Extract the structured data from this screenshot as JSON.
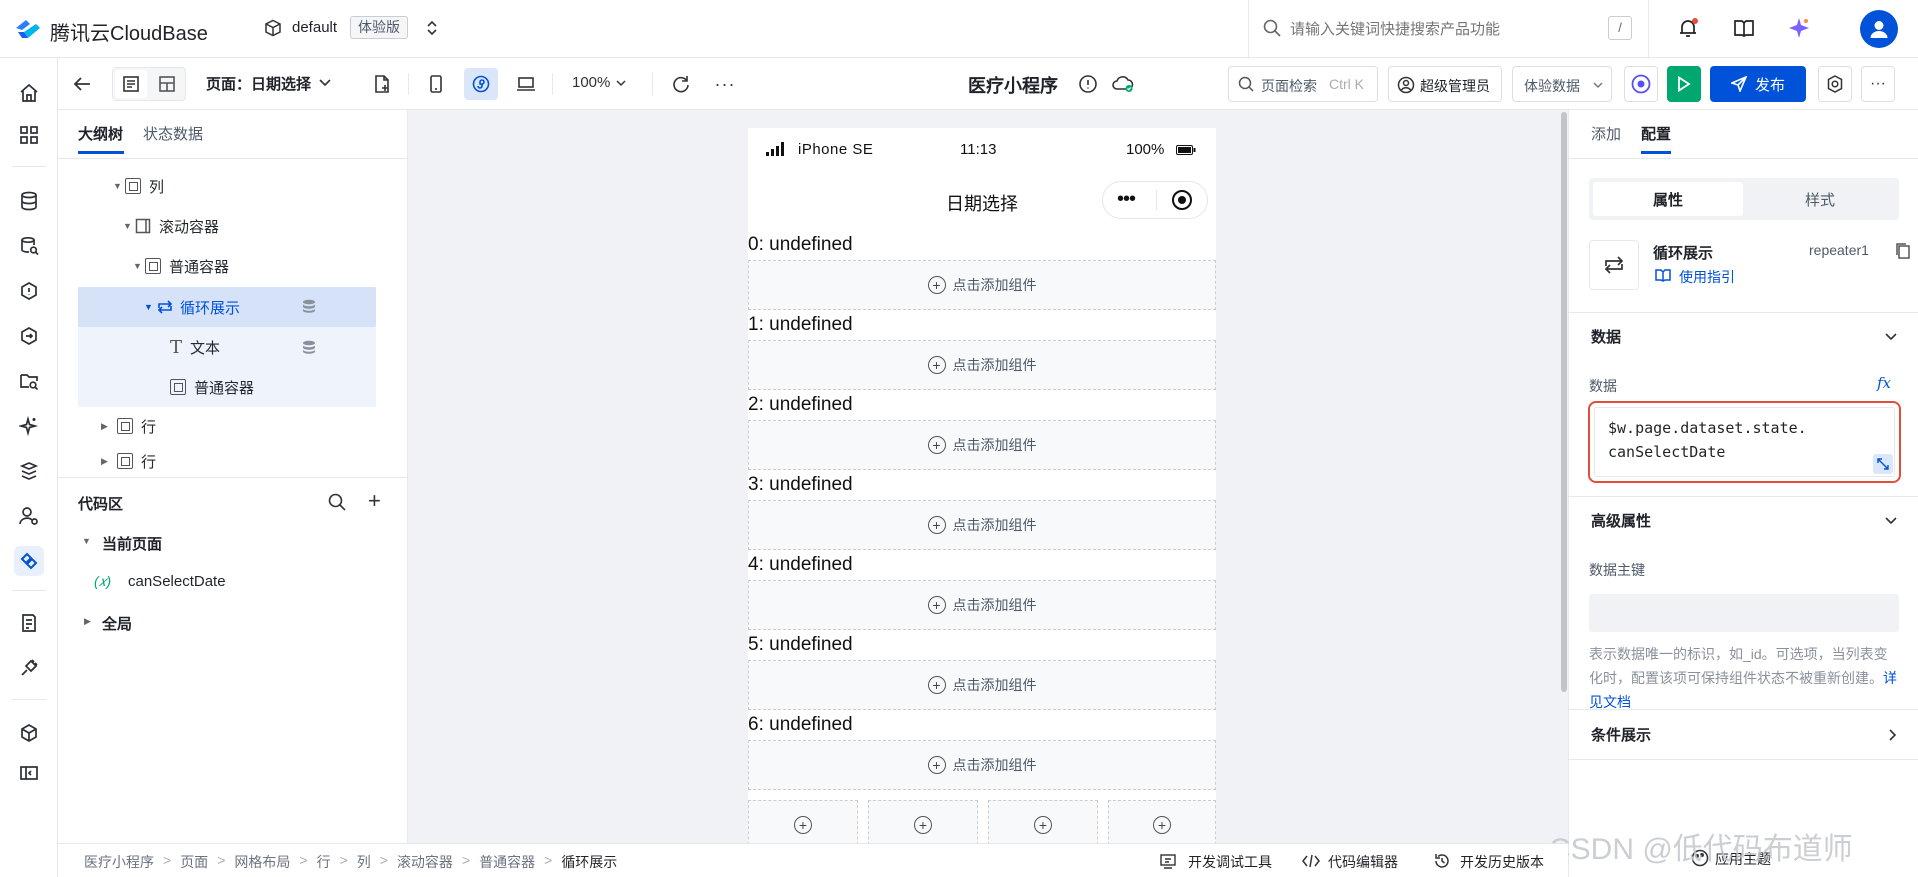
{
  "app": {
    "title": "腾讯云CloudBase",
    "env_name": "default",
    "env_badge": "体验版"
  },
  "header": {
    "search_placeholder": "请输入关键词快捷搜索产品功能",
    "search_shortcut": "/"
  },
  "toolbar": {
    "page_label": "页面：日期选择",
    "zoom": "100%",
    "project_title": "医疗小程序",
    "page_search": "页面检索",
    "page_search_shortcut": "Ctrl K",
    "admin": "超级管理员",
    "data_mode": "体验数据",
    "publish": "发布"
  },
  "left_panel": {
    "tabs": [
      "大纲树",
      "状态数据"
    ],
    "tree": [
      {
        "label": "列",
        "indent": 0
      },
      {
        "label": "滚动容器",
        "indent": 1
      },
      {
        "label": "普通容器",
        "indent": 2
      },
      {
        "label": "循环展示",
        "indent": 3
      },
      {
        "label": "文本",
        "indent": 4
      },
      {
        "label": "普通容器",
        "indent": 4
      },
      {
        "label": "行",
        "indent": 0
      },
      {
        "label": "行",
        "indent": 0
      }
    ],
    "code_title": "代码区",
    "code_current": "当前页面",
    "code_var": "canSelectDate",
    "code_var_icon": "(𝑥)",
    "code_global": "全局"
  },
  "phone": {
    "device": "iPhone SE",
    "time": "11:13",
    "battery": "100%",
    "page_title": "日期选择",
    "items": [
      "0: undefined",
      "1: undefined",
      "2: undefined",
      "3: undefined",
      "4: undefined",
      "5: undefined",
      "6: undefined"
    ],
    "add_component": "点击添加组件"
  },
  "right_panel": {
    "tabs": [
      "添加",
      "配置"
    ],
    "subtabs": [
      "属性",
      "样式"
    ],
    "component_name": "循环展示",
    "component_id": "repeater1",
    "guide_link": "使用指引",
    "data_section": "数据",
    "data_label": "数据",
    "fx": "fx",
    "data_expr_line1": "$w.page.dataset.state.",
    "data_expr_line2": "canSelectDate",
    "advanced_section": "高级属性",
    "key_label": "数据主键",
    "key_help": "表示数据唯一的标识，如_id。可选项，当列表变化时，配置该项可保持组件状态不被重新创建。",
    "doc_link": "详见文档",
    "cond_section": "条件展示"
  },
  "statusbar": {
    "breadcrumb": [
      "医疗小程序",
      "页面",
      "网格布局",
      "行",
      "列",
      "滚动容器",
      "普通容器",
      "循环展示"
    ],
    "tools": [
      "开发调试工具",
      "代码编辑器",
      "开发历史版本"
    ],
    "theme": "应用主题",
    "watermark": "CSDN @低代码布道师"
  },
  "colors": {
    "accent": "#0052d9",
    "selected_bg": "#dbe6fb",
    "publish": "#0052d9",
    "run": "#00a870",
    "highlight_border": "#e34d3b"
  }
}
